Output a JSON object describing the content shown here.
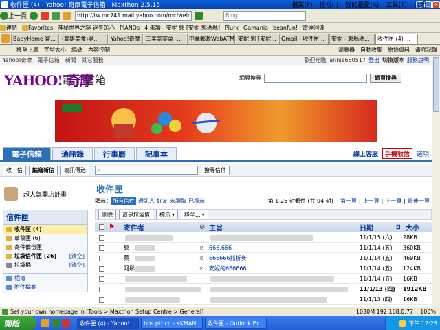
{
  "window": {
    "title": "收件匣 (4) - Yahoo! 奇摩電子信箱 - Maxthon 2.5.15"
  },
  "menu": [
    "檔案(F)",
    "檢視(I)",
    "我的最愛(A)",
    "工具(T)",
    "說明"
  ],
  "toolbar": {
    "back": "上一頁",
    "address": "http://tw.mc741.mail.yahoo.com/mc/welcome?",
    "search_placeholder": "Bing"
  },
  "favbar": [
    "連結",
    "Favorites",
    "神秘世界之謎-迷失的心",
    "PIANOs",
    "4 未讀 - 安妮 郭 [安妮-郭瑪瑪]",
    "Plurk",
    "Gamania",
    "beanfun!",
    "雷達回波"
  ],
  "tabs": [
    "BabyHome 寶...",
    "(高雄美食)吳...",
    "Yahoo!奇摩",
    "三美家宴菜 -...",
    "中華郵政WebATM",
    "安妮 郭 [安妮...",
    "Gmail - 收件匣...",
    "安妮 - 郭瑪瑪...",
    "收件匣 (4) ..."
  ],
  "navbar": {
    "home": "移至上層",
    "font": "字型大小",
    "edit": "編碼",
    "content": "內容控制",
    "ads": "瀏覽器",
    "autocollect": "自動收集",
    "viewsource": "原始資料",
    "clear": "清除記錄"
  },
  "yahoo_nav": {
    "links": [
      "Yahoo!奇摩",
      "電子信箱",
      "新聞",
      "其它服務"
    ],
    "greeting": "歡迎光臨, annie650517",
    "logout": "登出",
    "switch": "切換版本",
    "help": "服務說明"
  },
  "logo": {
    "brand": "YAHOO! 奇摩",
    "product": "電子信箱"
  },
  "websearch": {
    "label": "網頁搜尋",
    "button": "網頁搜尋"
  },
  "main_tabs": [
    "電子信箱",
    "通訊錄",
    "行事曆",
    "記事本"
  ],
  "main_links": {
    "online": "線上客服",
    "mobile": "手機收信",
    "options": "選項"
  },
  "actions": {
    "receive": "收　信",
    "compose": "編寫新信",
    "sms": "簡訊傳送",
    "search": "搜尋信件"
  },
  "user": {
    "label": "超人氣開店計畫"
  },
  "mailbox": {
    "header": "信件匣",
    "folders": [
      {
        "name": "收件匣 (4)",
        "action": ""
      },
      {
        "name": "草稿匣 (6)",
        "action": ""
      },
      {
        "name": "寄件備份匣",
        "action": ""
      },
      {
        "name": "垃圾信件匣 (26)",
        "action": "[清空]"
      },
      {
        "name": "垃圾桶",
        "action": "[清空]"
      }
    ],
    "extras": [
      "相簿",
      "附件檔案"
    ]
  },
  "inbox": {
    "title": "收件匣",
    "show_label": "顯示：",
    "filters": [
      "所有信件",
      "通訊人",
      "好友",
      "未讀取",
      "已標示"
    ],
    "count": "第 1-25 封郵件 (共 94 封)",
    "pager": [
      "第一頁",
      "上一頁",
      "下一頁",
      "最後一頁"
    ],
    "buttons": [
      "刪除",
      "這是垃圾信",
      "標示",
      "移至..."
    ],
    "columns": {
      "from": "寄件者",
      "subject": "主旨",
      "date": "日期",
      "size": "大小"
    },
    "rows": [
      {
        "from": "",
        "subject": "",
        "date": "11/1/15 (六)",
        "size": "28KB",
        "clip": false
      },
      {
        "from": "郭",
        "subject": "666.666",
        "date": "11/1/14 (五)",
        "size": "360KB",
        "clip": true
      },
      {
        "from": "蔡",
        "subject": "666666抓折奏",
        "date": "11/1/14 (五)",
        "size": "469KB",
        "clip": true
      },
      {
        "from": "阿彤",
        "subject": "安妮的666666",
        "date": "11/1/14 (五)",
        "size": "124KB",
        "clip": true
      },
      {
        "from": "",
        "subject": "",
        "date": "11/1/14 (五)",
        "size": "16KB",
        "clip": false
      },
      {
        "from": "",
        "subject": "",
        "date": "11/1/13 (四)",
        "size": "1912KB",
        "clip": false
      },
      {
        "from": "",
        "subject": "",
        "date": "11/1/13 (四)",
        "size": "16KB",
        "clip": false
      }
    ]
  },
  "statusbar": {
    "text": "Set your own homepage in [Tools > Maxthon Setup Centre > General]",
    "info": "1030M 192.168.0.77",
    "zoom": "100%"
  },
  "taskbar": {
    "start": "開始",
    "tasks": [
      "收件匣 (4) - Yahoo!...",
      "bbs.ptt.cc - KKMAN",
      "收件匣 - Outlook Ex..."
    ],
    "clock": "下午 12:23"
  },
  "colors": {
    "yahoo_purple": "#7b0099",
    "accent_blue": "#2c6fb8",
    "title_blue": "#0a5fd8"
  }
}
